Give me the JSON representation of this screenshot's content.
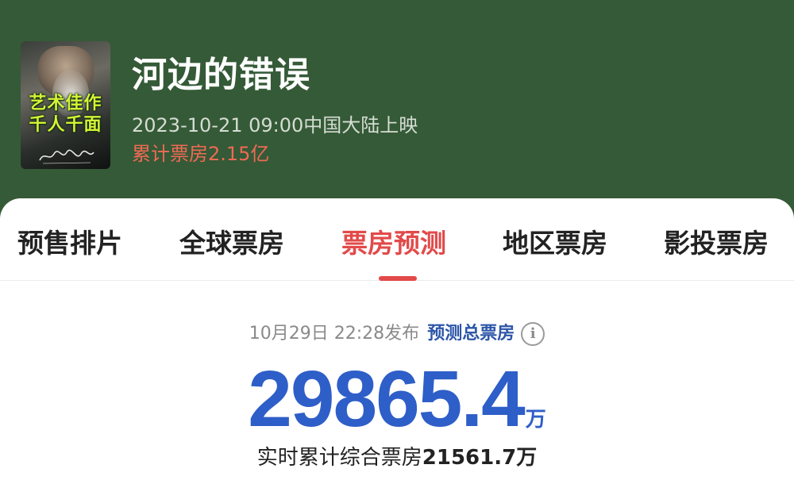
{
  "movie": {
    "title": "河边的错误",
    "release": "2023-10-21 09:00中国大陆上映",
    "cumulative_box_office": "累计票房2.15亿",
    "poster_text": [
      "艺术佳作",
      "千人千面"
    ]
  },
  "tabs": [
    {
      "label": "预售排片",
      "active": false
    },
    {
      "label": "全球票房",
      "active": false
    },
    {
      "label": "票房预测",
      "active": true
    },
    {
      "label": "地区票房",
      "active": false
    },
    {
      "label": "影投票房",
      "active": false
    }
  ],
  "forecast": {
    "published": "10月29日 22:28发布",
    "label": "预测总票房",
    "value": "29865.4",
    "unit": "万",
    "realtime_label": "实时累计综合票房",
    "realtime_value": "21561.7万"
  },
  "colors": {
    "header_bg": "#355a37",
    "accent_red": "#e24a4a",
    "forecast_blue": "#2e5ec8",
    "box_office_red": "#ef6a55"
  }
}
